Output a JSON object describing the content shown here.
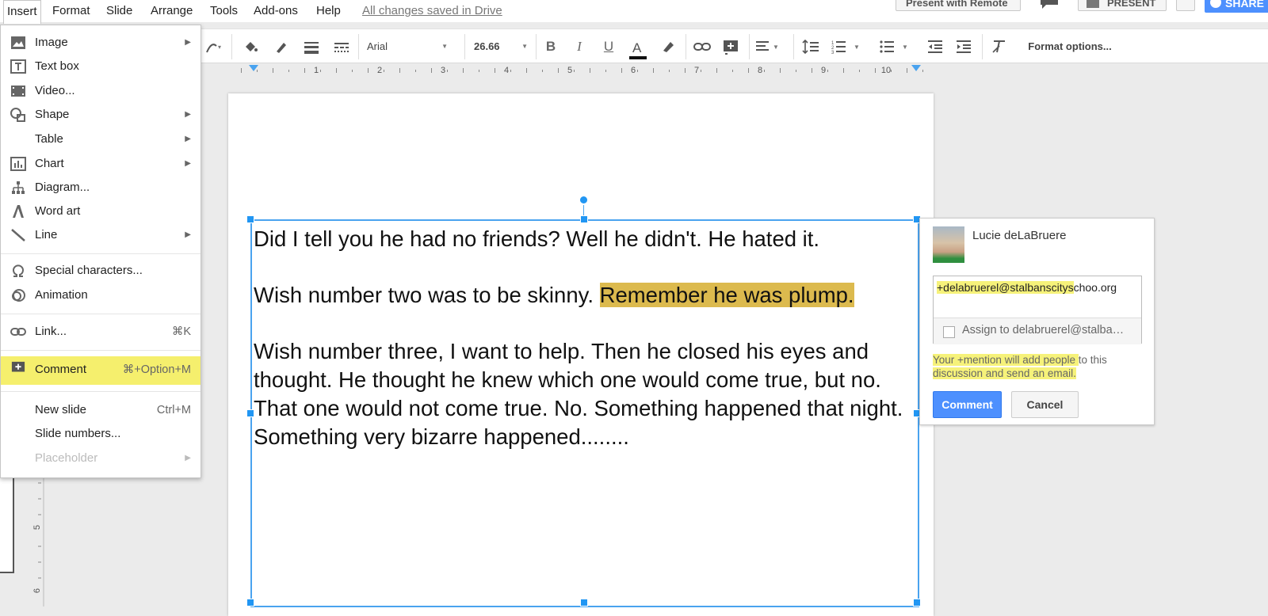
{
  "menubar": {
    "items": [
      "Insert",
      "Format",
      "Slide",
      "Arrange",
      "Tools",
      "Add-ons",
      "Help"
    ],
    "saved_status": "All changes saved in Drive",
    "present_remote_label": "Present with Remote",
    "present_label": "PRESENT",
    "share_label": "SHARE"
  },
  "toolbar": {
    "font_family": "Arial",
    "font_size": "26.66",
    "format_options_label": "Format options..."
  },
  "ruler": {
    "h_numbers": [
      "1",
      "2",
      "3",
      "4",
      "5",
      "6",
      "7",
      "8",
      "9",
      "10"
    ],
    "v_numbers": [
      "5",
      "6"
    ]
  },
  "insert_menu": {
    "items": [
      {
        "label": "Image",
        "icon": "image-icon",
        "submenu": true
      },
      {
        "label": "Text box",
        "icon": "text-box-icon"
      },
      {
        "label": "Video...",
        "icon": "video-icon"
      },
      {
        "label": "Shape",
        "icon": "shape-icon",
        "submenu": true
      },
      {
        "label": "Table",
        "icon": "",
        "submenu": true
      },
      {
        "label": "Chart",
        "icon": "chart-icon",
        "submenu": true
      },
      {
        "label": "Diagram...",
        "icon": "diagram-icon"
      },
      {
        "label": "Word art",
        "icon": "word-art-icon"
      },
      {
        "label": "Line",
        "icon": "line-icon",
        "submenu": true
      },
      {
        "label": "Special characters...",
        "icon": "omega-icon"
      },
      {
        "label": "Animation",
        "icon": "animation-icon"
      },
      {
        "label": "Link...",
        "icon": "link-icon",
        "shortcut": "⌘K"
      },
      {
        "label": "Comment",
        "icon": "add-comment-icon",
        "shortcut": "⌘+Option+M",
        "highlighted": true
      },
      {
        "label": "New slide",
        "icon": "",
        "shortcut": "Ctrl+M"
      },
      {
        "label": "Slide numbers...",
        "icon": ""
      },
      {
        "label": "Placeholder",
        "icon": "",
        "submenu": true,
        "disabled": true
      }
    ]
  },
  "slide": {
    "line1": "Did I tell you he had no friends? Well he didn't. He hated it.",
    "line2_plain": "Wish number two was to be skinny. ",
    "line2_highlight": "Remember he was plump.",
    "paragraph3": "Wish number three, I want to help. Then he closed his eyes and thought. He thought he knew which one would come true, but no. That one would not come true. No. Something happened that night. Something very bizarre happened........",
    "highlight_color": "#dcba4e"
  },
  "comment": {
    "author": "Lucie deLaBruere",
    "input_highlighted": "+delabruerel@stalbanscitys",
    "input_rest": "choo.org",
    "assign_label": "Assign to delabruerel@stalba…",
    "notice_highlighted": "Your +mention will add people ",
    "notice_rest": "to this",
    "notice_line2": "discussion and send an email.",
    "comment_button": "Comment",
    "cancel_button": "Cancel"
  },
  "colors": {
    "accent": "#4d90fe",
    "menu_highlight": "#f5ef6d",
    "selection": "#4aa3ef"
  }
}
